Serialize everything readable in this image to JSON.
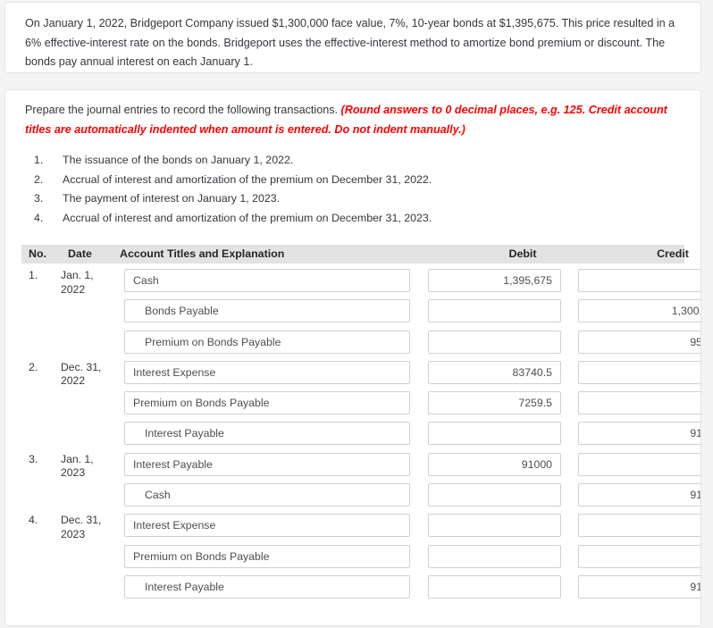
{
  "problem": {
    "text": "On January 1, 2022, Bridgeport Company issued $1,300,000 face value, 7%, 10-year bonds at $1,395,675. This price resulted in a 6% effective-interest rate on the bonds. Bridgeport uses the effective-interest method to amortize bond premium or discount. The bonds pay annual interest on each January 1."
  },
  "instructions": {
    "lead": "Prepare the journal entries to record the following transactions. ",
    "note": "(Round answers to 0 decimal places, e.g. 125. Credit account titles are automatically indented when amount is entered. Do not indent manually.)",
    "note_color": "#ff0000",
    "transactions": [
      {
        "num": "1.",
        "text": "The issuance of the bonds on January 1, 2022."
      },
      {
        "num": "2.",
        "text": "Accrual of interest and amortization of the premium on December 31, 2022."
      },
      {
        "num": "3.",
        "text": "The payment of interest on January 1, 2023."
      },
      {
        "num": "4.",
        "text": "Accrual of interest and amortization of the premium on December 31, 2023."
      }
    ]
  },
  "journal": {
    "headers": {
      "no": "No.",
      "date": "Date",
      "account": "Account Titles and Explanation",
      "debit": "Debit",
      "credit": "Credit"
    },
    "rows": [
      {
        "no": "1.",
        "date": "Jan. 1, 2022",
        "account": "Cash",
        "indent": false,
        "debit": "1,395,675",
        "credit": ""
      },
      {
        "no": "",
        "date": "",
        "account": "Bonds Payable",
        "indent": true,
        "debit": "",
        "credit": "1,300,"
      },
      {
        "no": "",
        "date": "",
        "account": "Premium on Bonds Payable",
        "indent": true,
        "debit": "",
        "credit": "95"
      },
      {
        "no": "2.",
        "date": "Dec. 31, 2022",
        "account": "Interest Expense",
        "indent": false,
        "debit": "83740.5",
        "credit": ""
      },
      {
        "no": "",
        "date": "",
        "account": "Premium on Bonds Payable",
        "indent": false,
        "debit": "7259.5",
        "credit": ""
      },
      {
        "no": "",
        "date": "",
        "account": "Interest Payable",
        "indent": true,
        "debit": "",
        "credit": "91"
      },
      {
        "no": "3.",
        "date": "Jan. 1, 2023",
        "account": "Interest Payable",
        "indent": false,
        "debit": "91000",
        "credit": ""
      },
      {
        "no": "",
        "date": "",
        "account": "Cash",
        "indent": true,
        "debit": "",
        "credit": "91"
      },
      {
        "no": "4.",
        "date": "Dec. 31, 2023",
        "account": "Interest Expense",
        "indent": false,
        "debit": "",
        "credit": ""
      },
      {
        "no": "",
        "date": "",
        "account": "Premium on Bonds Payable",
        "indent": false,
        "debit": "",
        "credit": ""
      },
      {
        "no": "",
        "date": "",
        "account": "Interest Payable",
        "indent": true,
        "debit": "",
        "credit": "91"
      }
    ]
  }
}
